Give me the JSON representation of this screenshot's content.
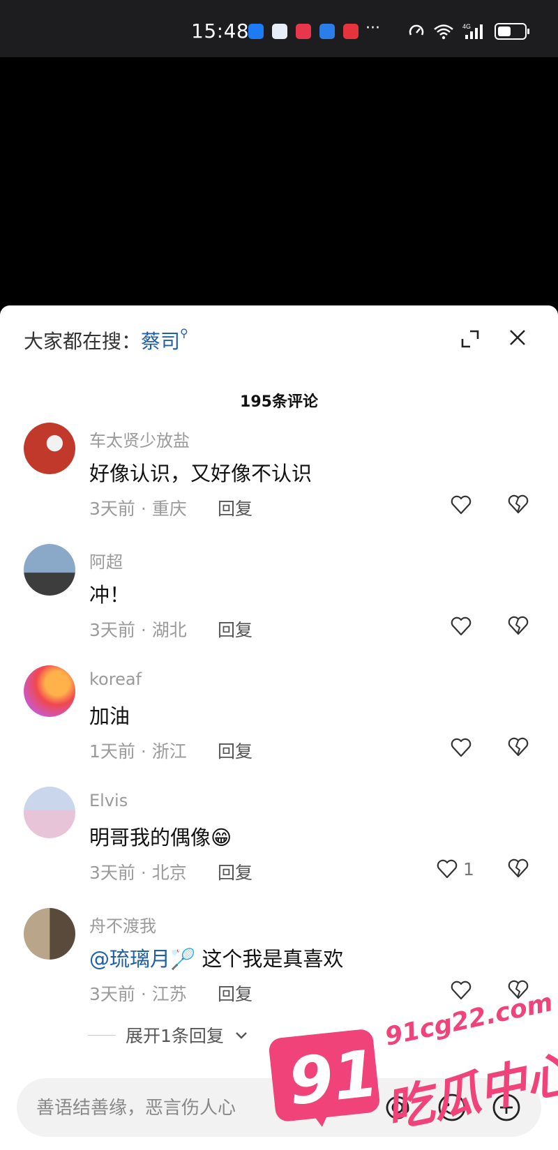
{
  "status_bar": {
    "time": "15:48",
    "more": "···",
    "network": "4G"
  },
  "sheet": {
    "search_prompt": "大家都在搜：",
    "search_term": "蔡司",
    "comment_count": "195条评论"
  },
  "comments": [
    {
      "user": "车太贤少放盐",
      "text": "好像认识，又好像不认识",
      "time": "3天前",
      "location": "重庆",
      "reply": "回复",
      "likes": ""
    },
    {
      "user": "阿超",
      "text": "冲！",
      "time": "3天前",
      "location": "湖北",
      "reply": "回复",
      "likes": ""
    },
    {
      "user": "koreaf",
      "text": "加油",
      "time": "1天前",
      "location": "浙江",
      "reply": "回复",
      "likes": ""
    },
    {
      "user": "Elvis",
      "text": "明哥我的偶像😁",
      "time": "3天前",
      "location": "北京",
      "reply": "回复",
      "likes": "1"
    },
    {
      "user": "舟不渡我",
      "mention": "@琉璃月",
      "text": "🏸 这个我是真喜欢",
      "time": "3天前",
      "location": "江苏",
      "reply": "回复",
      "likes": ""
    }
  ],
  "expand_replies": "展开1条回复",
  "input": {
    "placeholder": "善语结善缘，恶言伤人心"
  },
  "watermark": {
    "number": "91",
    "domain": "91cg22.com",
    "name": "吃瓜中心"
  },
  "colors": {
    "link": "#1f5fa8",
    "watermark": "#f0437a"
  }
}
